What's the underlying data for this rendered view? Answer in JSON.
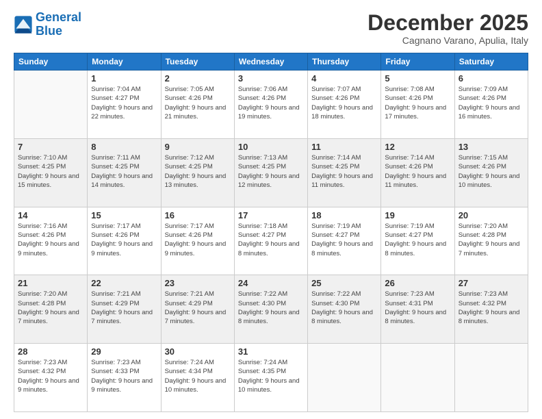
{
  "logo": {
    "line1": "General",
    "line2": "Blue"
  },
  "header": {
    "month": "December 2025",
    "location": "Cagnano Varano, Apulia, Italy"
  },
  "weekdays": [
    "Sunday",
    "Monday",
    "Tuesday",
    "Wednesday",
    "Thursday",
    "Friday",
    "Saturday"
  ],
  "weeks": [
    [
      {
        "day": null
      },
      {
        "day": "1",
        "sunrise": "7:04 AM",
        "sunset": "4:27 PM",
        "daylight": "9 hours and 22 minutes."
      },
      {
        "day": "2",
        "sunrise": "7:05 AM",
        "sunset": "4:26 PM",
        "daylight": "9 hours and 21 minutes."
      },
      {
        "day": "3",
        "sunrise": "7:06 AM",
        "sunset": "4:26 PM",
        "daylight": "9 hours and 19 minutes."
      },
      {
        "day": "4",
        "sunrise": "7:07 AM",
        "sunset": "4:26 PM",
        "daylight": "9 hours and 18 minutes."
      },
      {
        "day": "5",
        "sunrise": "7:08 AM",
        "sunset": "4:26 PM",
        "daylight": "9 hours and 17 minutes."
      },
      {
        "day": "6",
        "sunrise": "7:09 AM",
        "sunset": "4:26 PM",
        "daylight": "9 hours and 16 minutes."
      }
    ],
    [
      {
        "day": "7",
        "sunrise": "7:10 AM",
        "sunset": "4:25 PM",
        "daylight": "9 hours and 15 minutes."
      },
      {
        "day": "8",
        "sunrise": "7:11 AM",
        "sunset": "4:25 PM",
        "daylight": "9 hours and 14 minutes."
      },
      {
        "day": "9",
        "sunrise": "7:12 AM",
        "sunset": "4:25 PM",
        "daylight": "9 hours and 13 minutes."
      },
      {
        "day": "10",
        "sunrise": "7:13 AM",
        "sunset": "4:25 PM",
        "daylight": "9 hours and 12 minutes."
      },
      {
        "day": "11",
        "sunrise": "7:14 AM",
        "sunset": "4:25 PM",
        "daylight": "9 hours and 11 minutes."
      },
      {
        "day": "12",
        "sunrise": "7:14 AM",
        "sunset": "4:26 PM",
        "daylight": "9 hours and 11 minutes."
      },
      {
        "day": "13",
        "sunrise": "7:15 AM",
        "sunset": "4:26 PM",
        "daylight": "9 hours and 10 minutes."
      }
    ],
    [
      {
        "day": "14",
        "sunrise": "7:16 AM",
        "sunset": "4:26 PM",
        "daylight": "9 hours and 9 minutes."
      },
      {
        "day": "15",
        "sunrise": "7:17 AM",
        "sunset": "4:26 PM",
        "daylight": "9 hours and 9 minutes."
      },
      {
        "day": "16",
        "sunrise": "7:17 AM",
        "sunset": "4:26 PM",
        "daylight": "9 hours and 9 minutes."
      },
      {
        "day": "17",
        "sunrise": "7:18 AM",
        "sunset": "4:27 PM",
        "daylight": "9 hours and 8 minutes."
      },
      {
        "day": "18",
        "sunrise": "7:19 AM",
        "sunset": "4:27 PM",
        "daylight": "9 hours and 8 minutes."
      },
      {
        "day": "19",
        "sunrise": "7:19 AM",
        "sunset": "4:27 PM",
        "daylight": "9 hours and 8 minutes."
      },
      {
        "day": "20",
        "sunrise": "7:20 AM",
        "sunset": "4:28 PM",
        "daylight": "9 hours and 7 minutes."
      }
    ],
    [
      {
        "day": "21",
        "sunrise": "7:20 AM",
        "sunset": "4:28 PM",
        "daylight": "9 hours and 7 minutes."
      },
      {
        "day": "22",
        "sunrise": "7:21 AM",
        "sunset": "4:29 PM",
        "daylight": "9 hours and 7 minutes."
      },
      {
        "day": "23",
        "sunrise": "7:21 AM",
        "sunset": "4:29 PM",
        "daylight": "9 hours and 7 minutes."
      },
      {
        "day": "24",
        "sunrise": "7:22 AM",
        "sunset": "4:30 PM",
        "daylight": "9 hours and 8 minutes."
      },
      {
        "day": "25",
        "sunrise": "7:22 AM",
        "sunset": "4:30 PM",
        "daylight": "9 hours and 8 minutes."
      },
      {
        "day": "26",
        "sunrise": "7:23 AM",
        "sunset": "4:31 PM",
        "daylight": "9 hours and 8 minutes."
      },
      {
        "day": "27",
        "sunrise": "7:23 AM",
        "sunset": "4:32 PM",
        "daylight": "9 hours and 8 minutes."
      }
    ],
    [
      {
        "day": "28",
        "sunrise": "7:23 AM",
        "sunset": "4:32 PM",
        "daylight": "9 hours and 9 minutes."
      },
      {
        "day": "29",
        "sunrise": "7:23 AM",
        "sunset": "4:33 PM",
        "daylight": "9 hours and 9 minutes."
      },
      {
        "day": "30",
        "sunrise": "7:24 AM",
        "sunset": "4:34 PM",
        "daylight": "9 hours and 10 minutes."
      },
      {
        "day": "31",
        "sunrise": "7:24 AM",
        "sunset": "4:35 PM",
        "daylight": "9 hours and 10 minutes."
      },
      {
        "day": null
      },
      {
        "day": null
      },
      {
        "day": null
      }
    ]
  ]
}
